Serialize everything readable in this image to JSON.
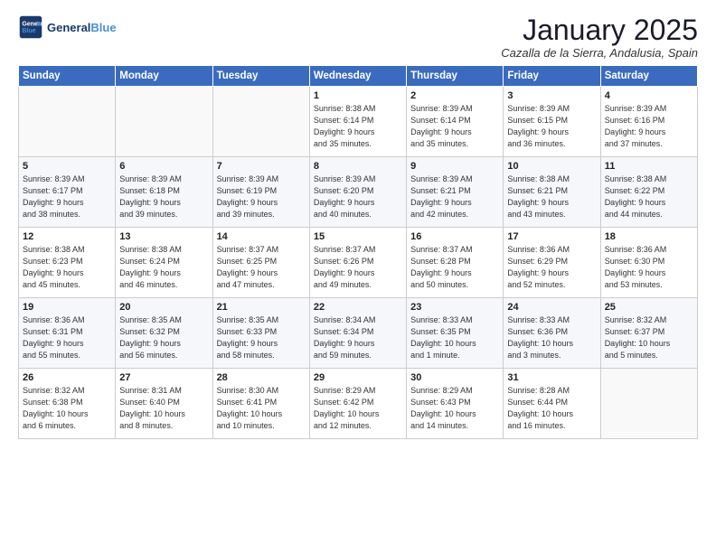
{
  "header": {
    "logo_line1": "General",
    "logo_line2": "Blue",
    "title": "January 2025",
    "subtitle": "Cazalla de la Sierra, Andalusia, Spain"
  },
  "weekdays": [
    "Sunday",
    "Monday",
    "Tuesday",
    "Wednesday",
    "Thursday",
    "Friday",
    "Saturday"
  ],
  "weeks": [
    [
      {
        "day": "",
        "info": ""
      },
      {
        "day": "",
        "info": ""
      },
      {
        "day": "",
        "info": ""
      },
      {
        "day": "1",
        "info": "Sunrise: 8:38 AM\nSunset: 6:14 PM\nDaylight: 9 hours\nand 35 minutes."
      },
      {
        "day": "2",
        "info": "Sunrise: 8:39 AM\nSunset: 6:14 PM\nDaylight: 9 hours\nand 35 minutes."
      },
      {
        "day": "3",
        "info": "Sunrise: 8:39 AM\nSunset: 6:15 PM\nDaylight: 9 hours\nand 36 minutes."
      },
      {
        "day": "4",
        "info": "Sunrise: 8:39 AM\nSunset: 6:16 PM\nDaylight: 9 hours\nand 37 minutes."
      }
    ],
    [
      {
        "day": "5",
        "info": "Sunrise: 8:39 AM\nSunset: 6:17 PM\nDaylight: 9 hours\nand 38 minutes."
      },
      {
        "day": "6",
        "info": "Sunrise: 8:39 AM\nSunset: 6:18 PM\nDaylight: 9 hours\nand 39 minutes."
      },
      {
        "day": "7",
        "info": "Sunrise: 8:39 AM\nSunset: 6:19 PM\nDaylight: 9 hours\nand 39 minutes."
      },
      {
        "day": "8",
        "info": "Sunrise: 8:39 AM\nSunset: 6:20 PM\nDaylight: 9 hours\nand 40 minutes."
      },
      {
        "day": "9",
        "info": "Sunrise: 8:39 AM\nSunset: 6:21 PM\nDaylight: 9 hours\nand 42 minutes."
      },
      {
        "day": "10",
        "info": "Sunrise: 8:38 AM\nSunset: 6:21 PM\nDaylight: 9 hours\nand 43 minutes."
      },
      {
        "day": "11",
        "info": "Sunrise: 8:38 AM\nSunset: 6:22 PM\nDaylight: 9 hours\nand 44 minutes."
      }
    ],
    [
      {
        "day": "12",
        "info": "Sunrise: 8:38 AM\nSunset: 6:23 PM\nDaylight: 9 hours\nand 45 minutes."
      },
      {
        "day": "13",
        "info": "Sunrise: 8:38 AM\nSunset: 6:24 PM\nDaylight: 9 hours\nand 46 minutes."
      },
      {
        "day": "14",
        "info": "Sunrise: 8:37 AM\nSunset: 6:25 PM\nDaylight: 9 hours\nand 47 minutes."
      },
      {
        "day": "15",
        "info": "Sunrise: 8:37 AM\nSunset: 6:26 PM\nDaylight: 9 hours\nand 49 minutes."
      },
      {
        "day": "16",
        "info": "Sunrise: 8:37 AM\nSunset: 6:28 PM\nDaylight: 9 hours\nand 50 minutes."
      },
      {
        "day": "17",
        "info": "Sunrise: 8:36 AM\nSunset: 6:29 PM\nDaylight: 9 hours\nand 52 minutes."
      },
      {
        "day": "18",
        "info": "Sunrise: 8:36 AM\nSunset: 6:30 PM\nDaylight: 9 hours\nand 53 minutes."
      }
    ],
    [
      {
        "day": "19",
        "info": "Sunrise: 8:36 AM\nSunset: 6:31 PM\nDaylight: 9 hours\nand 55 minutes."
      },
      {
        "day": "20",
        "info": "Sunrise: 8:35 AM\nSunset: 6:32 PM\nDaylight: 9 hours\nand 56 minutes."
      },
      {
        "day": "21",
        "info": "Sunrise: 8:35 AM\nSunset: 6:33 PM\nDaylight: 9 hours\nand 58 minutes."
      },
      {
        "day": "22",
        "info": "Sunrise: 8:34 AM\nSunset: 6:34 PM\nDaylight: 9 hours\nand 59 minutes."
      },
      {
        "day": "23",
        "info": "Sunrise: 8:33 AM\nSunset: 6:35 PM\nDaylight: 10 hours\nand 1 minute."
      },
      {
        "day": "24",
        "info": "Sunrise: 8:33 AM\nSunset: 6:36 PM\nDaylight: 10 hours\nand 3 minutes."
      },
      {
        "day": "25",
        "info": "Sunrise: 8:32 AM\nSunset: 6:37 PM\nDaylight: 10 hours\nand 5 minutes."
      }
    ],
    [
      {
        "day": "26",
        "info": "Sunrise: 8:32 AM\nSunset: 6:38 PM\nDaylight: 10 hours\nand 6 minutes."
      },
      {
        "day": "27",
        "info": "Sunrise: 8:31 AM\nSunset: 6:40 PM\nDaylight: 10 hours\nand 8 minutes."
      },
      {
        "day": "28",
        "info": "Sunrise: 8:30 AM\nSunset: 6:41 PM\nDaylight: 10 hours\nand 10 minutes."
      },
      {
        "day": "29",
        "info": "Sunrise: 8:29 AM\nSunset: 6:42 PM\nDaylight: 10 hours\nand 12 minutes."
      },
      {
        "day": "30",
        "info": "Sunrise: 8:29 AM\nSunset: 6:43 PM\nDaylight: 10 hours\nand 14 minutes."
      },
      {
        "day": "31",
        "info": "Sunrise: 8:28 AM\nSunset: 6:44 PM\nDaylight: 10 hours\nand 16 minutes."
      },
      {
        "day": "",
        "info": ""
      }
    ]
  ]
}
